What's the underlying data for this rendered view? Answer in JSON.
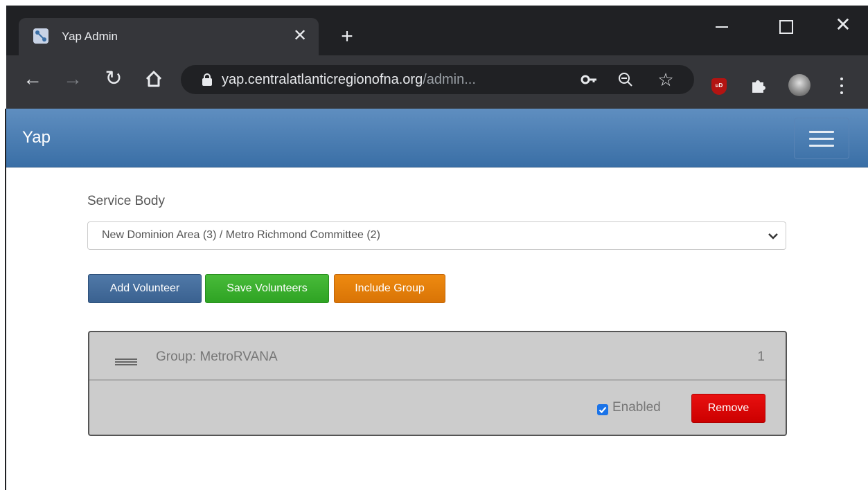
{
  "browser": {
    "tab_title": "Yap Admin",
    "tab_close_glyph": "✕",
    "new_tab_glyph": "+",
    "url_host": "yap.centralatlanticregionofna.org",
    "url_path": "/admin...",
    "icons": [
      "back-icon",
      "forward-icon",
      "reload-icon",
      "home-icon",
      "lock-icon",
      "key-icon",
      "zoom-icon",
      "star-icon",
      "ublock-icon",
      "puzzle-icon",
      "avatar",
      "menu-icon"
    ],
    "ublock_text": "uD"
  },
  "navbar": {
    "brand": "Yap"
  },
  "service_body": {
    "label": "Service Body",
    "selected": "New Dominion Area (3) / Metro Richmond Committee (2)"
  },
  "actions": {
    "add_volunteer": "Add Volunteer",
    "save_volunteers": "Save Volunteers",
    "include_group": "Include Group"
  },
  "group": {
    "title": "Group: MetroRVANA",
    "count": "1",
    "enabled_label": "Enabled",
    "enabled": true,
    "remove_label": "Remove"
  },
  "colors": {
    "navbar": "#3a6fa6",
    "add_button": "#3a6190",
    "save_button": "#2ea323",
    "include_button": "#d97406",
    "remove_button": "#cc0000",
    "checkbox": "#1a73e8"
  }
}
